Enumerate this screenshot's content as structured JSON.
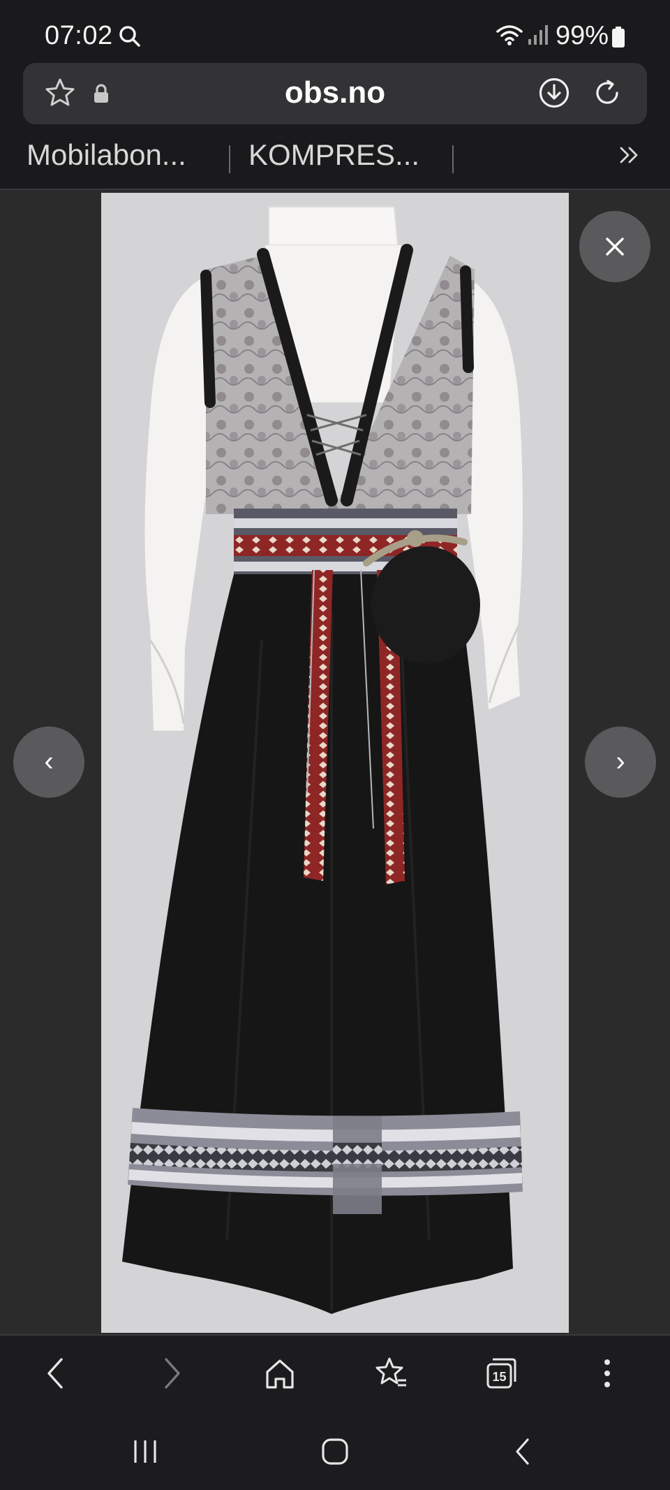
{
  "status_bar": {
    "time": "07:02",
    "battery": "99%",
    "icons": [
      "search-icon",
      "wifi-icon",
      "signal-icon",
      "battery-icon"
    ]
  },
  "browser": {
    "url": "obs.no",
    "url_bar_icons": [
      "star-icon",
      "lock-icon",
      "download-icon",
      "reload-icon"
    ],
    "bookmarks": [
      {
        "label": "Mobilabon..."
      },
      {
        "label": "KOMPRES..."
      }
    ]
  },
  "viewer": {
    "close_icon": "close-icon",
    "prev_label": "‹",
    "next_label": "›"
  },
  "toolbar": {
    "tabs_count": "15",
    "icons": [
      "back-icon",
      "forward-icon",
      "home-icon",
      "bookmarks-icon",
      "tabs-icon",
      "menu-icon"
    ]
  },
  "system_nav": {
    "icons": [
      "recents-icon",
      "home-icon",
      "back-icon"
    ]
  },
  "colors": {
    "background": "#1c1c1e",
    "url_bar": "#333336",
    "viewer_bg": "#2b2b2b",
    "photo_bg": "#d4d4d6",
    "overlay_button": "#5a5a5c"
  }
}
